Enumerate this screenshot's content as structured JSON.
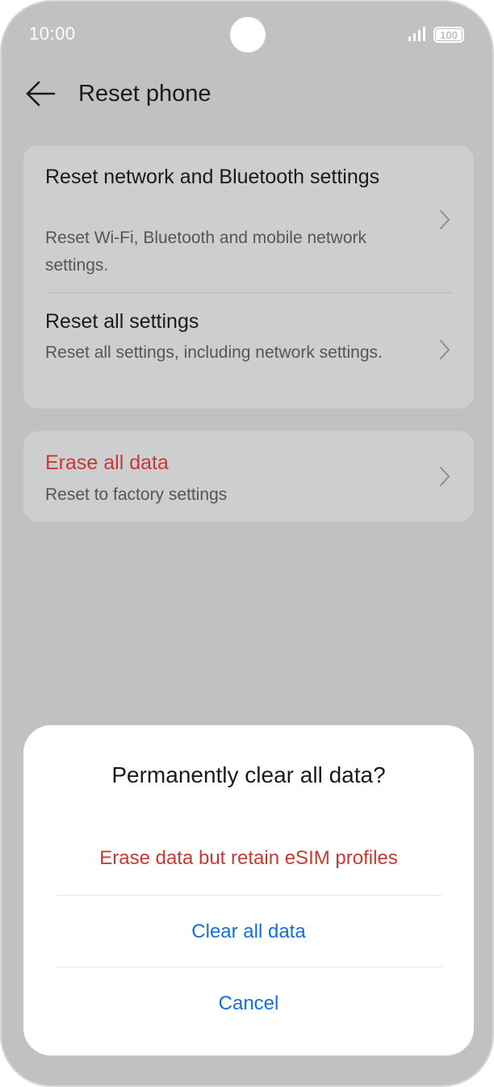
{
  "status_bar": {
    "time": "10:00",
    "battery": "100"
  },
  "header": {
    "title": "Reset phone"
  },
  "settings": {
    "group1": [
      {
        "title": "Reset network and Bluetooth settings",
        "subtitle": "Reset Wi-Fi, Bluetooth and mobile network settings."
      },
      {
        "title": "Reset all settings",
        "subtitle": "Reset all settings, including network settings."
      }
    ],
    "group2": [
      {
        "title": "Erase all data",
        "subtitle": "Reset to factory settings"
      }
    ]
  },
  "dialog": {
    "title": "Permanently clear all data?",
    "options": [
      {
        "label": "Erase data but retain eSIM profiles"
      },
      {
        "label": "Clear all data"
      },
      {
        "label": "Cancel"
      }
    ]
  },
  "colors": {
    "background": "#c0c1c3",
    "card": "#cdcecf",
    "destructive": "#c63a33",
    "accent": "#1470d8",
    "text": "#1b1b1b"
  }
}
